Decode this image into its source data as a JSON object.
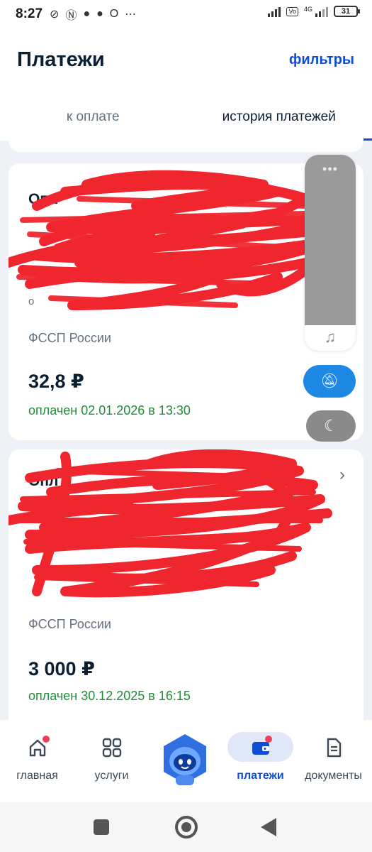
{
  "status_bar": {
    "time": "8:27",
    "network": "4G",
    "battery": "31"
  },
  "header": {
    "title": "Платежи",
    "filters_label": "фильтры"
  },
  "tabs": [
    {
      "label": "к оплате",
      "active": false
    },
    {
      "label": "история платежей",
      "active": true
    }
  ],
  "payments": [
    {
      "name_visible_fragment": "Опл",
      "sub_fragment": "о",
      "organization": "ФССП России",
      "amount": "32,8 ₽",
      "status": "оплачен 02.01.2026 в 13:30"
    },
    {
      "name_visible_fragment": "Опл",
      "sub_fragment": "",
      "organization": "ФССП России",
      "amount": "3 000 ₽",
      "status": "оплачен 30.12.2025 в 16:15"
    }
  ],
  "bottom_nav": [
    {
      "label": "главная",
      "icon": "home-icon",
      "badge": true
    },
    {
      "label": "услуги",
      "icon": "grid-icon",
      "badge": false
    },
    {
      "label": "",
      "icon": "robot-assistant-icon",
      "badge": false
    },
    {
      "label": "платежи",
      "icon": "wallet-icon",
      "badge": true,
      "active": true
    },
    {
      "label": "документы",
      "icon": "document-icon",
      "badge": false
    }
  ],
  "colors": {
    "accent": "#0d4cd3",
    "paid_status": "#1f8d3b",
    "redaction": "#f0262f",
    "badge": "#ee3f58"
  }
}
